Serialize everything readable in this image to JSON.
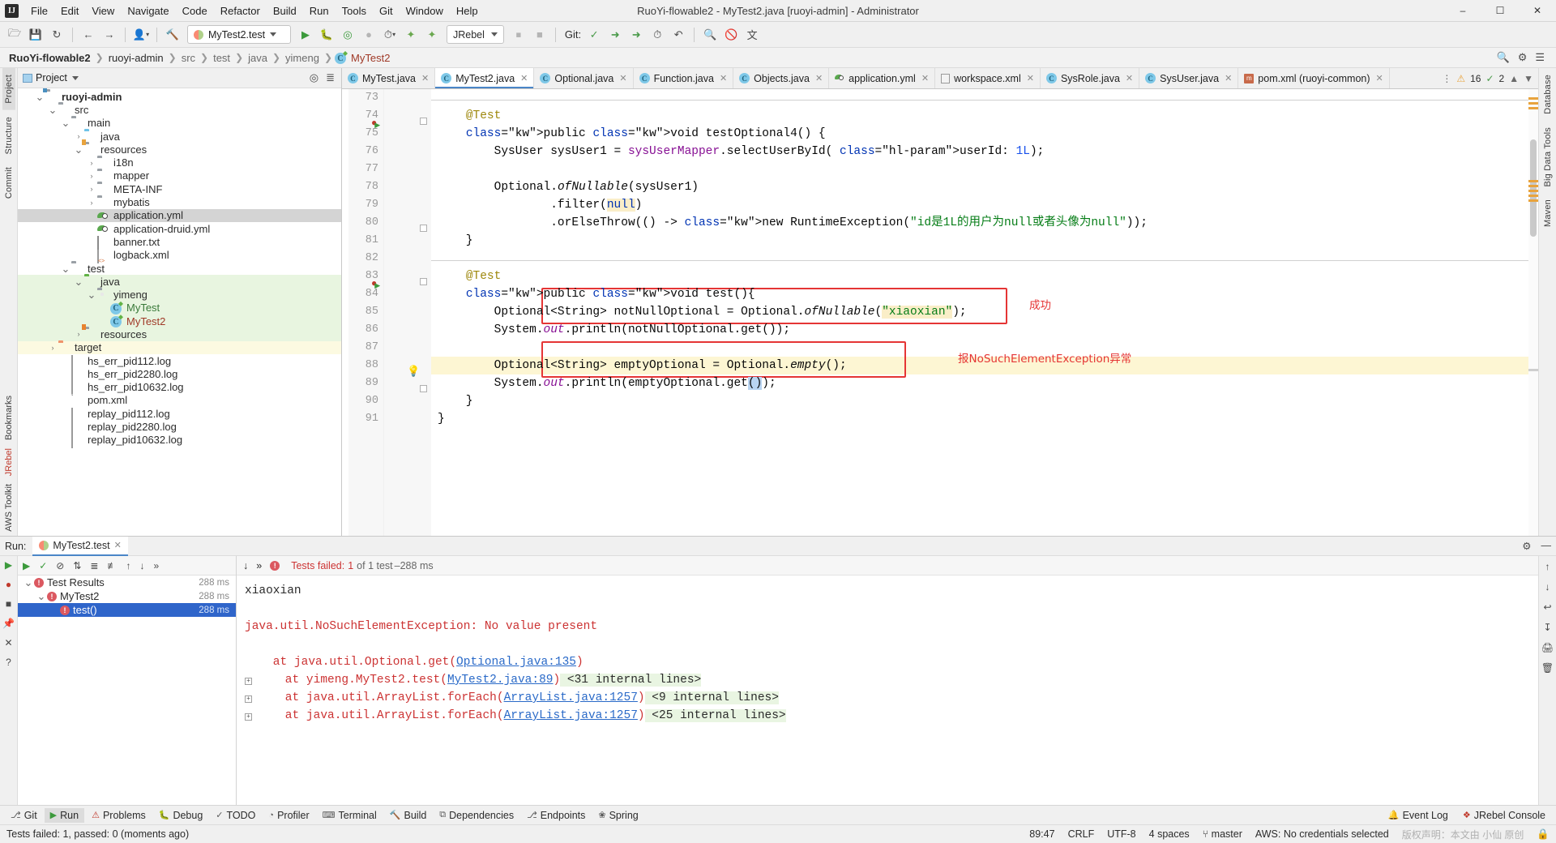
{
  "titlebar": {
    "logo": "IJ",
    "title": "RuoYi-flowable2 - MyTest2.java [ruoyi-admin] - Administrator",
    "menus": [
      "File",
      "Edit",
      "View",
      "Navigate",
      "Code",
      "Refactor",
      "Build",
      "Run",
      "Tools",
      "Git",
      "Window",
      "Help"
    ],
    "window_buttons": [
      "minimize",
      "maximize",
      "close"
    ]
  },
  "toolbar": {
    "run_config": "MyTest2.test",
    "jrebel": "JRebel",
    "git_label": "Git:",
    "icons": [
      "open-folder-icon",
      "save-icon",
      "sync-icon",
      "back-arrow-icon",
      "forward-arrow-icon",
      "profile-icon",
      "build-hammer-icon"
    ],
    "run_icons": [
      "run-icon",
      "debug-icon",
      "run-coverage-icon",
      "profile-run-icon",
      "run-with-icon"
    ],
    "jrebel_icons": [
      "jrebel-run-icon",
      "jrebel-debug-icon"
    ],
    "right_icons": [
      "search-icon",
      "settings-icon",
      "layout-icon"
    ]
  },
  "breadcrumb": {
    "items": [
      "RuoYi-flowable2",
      "ruoyi-admin",
      "src",
      "test",
      "java",
      "yimeng",
      "MyTest2"
    ],
    "separator": "›"
  },
  "left_bar": {
    "tabs": [
      "Project",
      "Structure",
      "Commit"
    ]
  },
  "right_bar": {
    "tabs": [
      "Database",
      "Big Data Tools",
      "Maven"
    ]
  },
  "project_panel": {
    "title": "Project",
    "header_icons": [
      "locate-icon",
      "collapse-all-icon"
    ],
    "tree": [
      {
        "indent": 1,
        "arrow": "v",
        "icon": "module-folder-icon",
        "label": "ruoyi-admin",
        "bold": true,
        "bg": ""
      },
      {
        "indent": 2,
        "arrow": "v",
        "icon": "folder-icon",
        "label": "src",
        "bg": ""
      },
      {
        "indent": 3,
        "arrow": "v",
        "icon": "folder-icon",
        "label": "main",
        "bg": ""
      },
      {
        "indent": 4,
        "arrow": ">",
        "icon": "source-folder-icon",
        "label": "java",
        "bg": ""
      },
      {
        "indent": 4,
        "arrow": "v",
        "icon": "resource-folder-icon",
        "label": "resources",
        "bg": ""
      },
      {
        "indent": 5,
        "arrow": ">",
        "icon": "folder-icon",
        "label": "i18n",
        "bg": ""
      },
      {
        "indent": 5,
        "arrow": ">",
        "icon": "folder-icon",
        "label": "mapper",
        "bg": ""
      },
      {
        "indent": 5,
        "arrow": ">",
        "icon": "folder-icon",
        "label": "META-INF",
        "bg": ""
      },
      {
        "indent": 5,
        "arrow": ">",
        "icon": "folder-icon",
        "label": "mybatis",
        "bg": ""
      },
      {
        "indent": 5,
        "arrow": "",
        "icon": "yml-file-icon",
        "label": "application.yml",
        "bg": "sel",
        "color": "#2b2b2b"
      },
      {
        "indent": 5,
        "arrow": "",
        "icon": "yml-file-icon",
        "label": "application-druid.yml",
        "bg": "",
        "color": "#2b2b2b"
      },
      {
        "indent": 5,
        "arrow": "",
        "icon": "text-file-icon",
        "label": "banner.txt",
        "bg": ""
      },
      {
        "indent": 5,
        "arrow": "",
        "icon": "xml-file-icon",
        "label": "logback.xml",
        "bg": ""
      },
      {
        "indent": 3,
        "arrow": "v",
        "icon": "folder-icon",
        "label": "test",
        "bg": ""
      },
      {
        "indent": 4,
        "arrow": "v",
        "icon": "test-source-folder-icon",
        "label": "java",
        "bg": "green"
      },
      {
        "indent": 5,
        "arrow": "v",
        "icon": "package-icon",
        "label": "yimeng",
        "bg": "green"
      },
      {
        "indent": 6,
        "arrow": "",
        "icon": "java-class-icon",
        "label": "MyTest",
        "bg": "green",
        "color": "#3a7a3a"
      },
      {
        "indent": 6,
        "arrow": "",
        "icon": "java-class-icon",
        "label": "MyTest2",
        "bg": "green",
        "color": "#a03a28"
      },
      {
        "indent": 4,
        "arrow": ">",
        "icon": "test-resource-folder-icon",
        "label": "resources",
        "bg": "green"
      },
      {
        "indent": 2,
        "arrow": ">",
        "icon": "target-folder-icon",
        "label": "target",
        "bg": "yellow"
      },
      {
        "indent": 3,
        "arrow": "",
        "icon": "log-file-icon",
        "label": "hs_err_pid112.log",
        "bg": ""
      },
      {
        "indent": 3,
        "arrow": "",
        "icon": "log-file-icon",
        "label": "hs_err_pid2280.log",
        "bg": ""
      },
      {
        "indent": 3,
        "arrow": "",
        "icon": "log-file-icon",
        "label": "hs_err_pid10632.log",
        "bg": ""
      },
      {
        "indent": 3,
        "arrow": "",
        "icon": "maven-pom-icon",
        "label": "pom.xml",
        "bg": ""
      },
      {
        "indent": 3,
        "arrow": "",
        "icon": "log-file-icon",
        "label": "replay_pid112.log",
        "bg": ""
      },
      {
        "indent": 3,
        "arrow": "",
        "icon": "log-file-icon",
        "label": "replay_pid2280.log",
        "bg": ""
      },
      {
        "indent": 3,
        "arrow": "",
        "icon": "log-file-icon",
        "label": "replay_pid10632.log",
        "bg": ""
      }
    ]
  },
  "editor": {
    "tabs": [
      {
        "label": "MyTest.java",
        "icon": "java-class-icon",
        "active": false,
        "closable": true
      },
      {
        "label": "MyTest2.java",
        "icon": "java-class-icon",
        "active": true,
        "closable": true
      },
      {
        "label": "Optional.java",
        "icon": "java-class-icon",
        "active": false,
        "closable": true
      },
      {
        "label": "Function.java",
        "icon": "java-class-icon",
        "active": false,
        "closable": true
      },
      {
        "label": "Objects.java",
        "icon": "java-class-icon",
        "active": false,
        "closable": true
      },
      {
        "label": "application.yml",
        "icon": "yml-file-icon",
        "active": false,
        "closable": true
      },
      {
        "label": "workspace.xml",
        "icon": "xml-file-icon",
        "active": false,
        "closable": true
      },
      {
        "label": "SysRole.java",
        "icon": "java-class-icon",
        "active": false,
        "closable": true
      },
      {
        "label": "SysUser.java",
        "icon": "java-class-icon",
        "active": false,
        "closable": true
      },
      {
        "label": "pom.xml (ruoyi-common)",
        "icon": "maven-pom-icon",
        "active": false,
        "closable": true
      }
    ],
    "inspection": {
      "warnings": "16",
      "checks": "2"
    },
    "first_line_number": 73,
    "lines": [
      {
        "n": 73,
        "text": ""
      },
      {
        "n": 74,
        "text": "    @Test"
      },
      {
        "n": 75,
        "text": "    public void testOptional4() {"
      },
      {
        "n": 76,
        "text": "        SysUser sysUser1 = sysUserMapper.selectUserById( userId: 1L);"
      },
      {
        "n": 77,
        "text": ""
      },
      {
        "n": 78,
        "text": "        Optional.ofNullable(sysUser1)"
      },
      {
        "n": 79,
        "text": "                .filter(null)"
      },
      {
        "n": 80,
        "text": "                .orElseThrow(() -> new RuntimeException(\"id是1L的用户为null或者头像为null\"));"
      },
      {
        "n": 81,
        "text": "    }"
      },
      {
        "n": 82,
        "text": ""
      },
      {
        "n": 83,
        "text": "    @Test"
      },
      {
        "n": 84,
        "text": "    public void test(){"
      },
      {
        "n": 85,
        "text": "        Optional<String> notNullOptional = Optional.ofNullable(\"xiaoxian\");"
      },
      {
        "n": 86,
        "text": "        System.out.println(notNullOptional.get());"
      },
      {
        "n": 87,
        "text": ""
      },
      {
        "n": 88,
        "text": "        Optional<String> emptyOptional = Optional.empty();"
      },
      {
        "n": 89,
        "text": "        System.out.println(emptyOptional.get());"
      },
      {
        "n": 90,
        "text": "    }"
      },
      {
        "n": 91,
        "text": "}"
      }
    ],
    "annotations": [
      {
        "text": "成功",
        "color": "#e53535"
      },
      {
        "text": "报NoSuchElementException异常",
        "color": "#e53535"
      }
    ]
  },
  "run_panel": {
    "label": "Run:",
    "tab": "MyTest2.test",
    "tab_icon": "run-config-icon",
    "toolbar_icons": [
      "rerun-icon",
      "rerun-failed-icon",
      "toggle-icon",
      "sort-icon",
      "expand-icon",
      "collapse-icon",
      "up-icon",
      "down-icon",
      "more-icon"
    ],
    "status": {
      "prefix": "Tests failed:",
      "count": "1",
      "of": "of 1 test",
      "duration": "288 ms"
    },
    "tree": [
      {
        "indent": 0,
        "arrow": "v",
        "label": "Test Results",
        "time": "288 ms",
        "sel": false,
        "error": true
      },
      {
        "indent": 1,
        "arrow": "v",
        "label": "MyTest2",
        "time": "288 ms",
        "sel": false,
        "error": true
      },
      {
        "indent": 2,
        "arrow": "",
        "label": "test()",
        "time": "288 ms",
        "sel": true,
        "error": true
      }
    ],
    "console": [
      {
        "segments": [
          {
            "t": "xiaoxian",
            "c": "plain"
          }
        ]
      },
      {
        "segments": []
      },
      {
        "segments": [
          {
            "t": "java.util.NoSuchElementException: No value present",
            "c": "err"
          }
        ]
      },
      {
        "segments": []
      },
      {
        "segments": [
          {
            "t": "    at java.util.Optional.get(",
            "c": "err"
          },
          {
            "t": "Optional.java:135",
            "c": "link"
          },
          {
            "t": ")",
            "c": "err"
          }
        ]
      },
      {
        "segments": [
          {
            "t": "    at yimeng.MyTest2.test(",
            "c": "err"
          },
          {
            "t": "MyTest2.java:89",
            "c": "link"
          },
          {
            "t": ")",
            "c": "err"
          },
          {
            "t": " <31 internal lines>",
            "c": "green"
          }
        ],
        "expandable": true
      },
      {
        "segments": [
          {
            "t": "    at java.util.ArrayList.forEach(",
            "c": "err"
          },
          {
            "t": "ArrayList.java:1257",
            "c": "link"
          },
          {
            "t": ")",
            "c": "err"
          },
          {
            "t": " <9 internal lines>",
            "c": "green"
          }
        ],
        "expandable": true
      },
      {
        "segments": [
          {
            "t": "    at java.util.ArrayList.forEach(",
            "c": "err"
          },
          {
            "t": "ArrayList.java:1257",
            "c": "link"
          },
          {
            "t": ")",
            "c": "err"
          },
          {
            "t": " <25 internal lines>",
            "c": "green"
          }
        ],
        "expandable": true
      }
    ],
    "side_icons": [
      "up-icon",
      "down-icon",
      "soft-wrap-icon",
      "scroll-to-end-icon",
      "print-icon",
      "clear-icon"
    ]
  },
  "bottom_bar": {
    "items": [
      {
        "label": "Git",
        "icon": "git-icon",
        "active": false
      },
      {
        "label": "Run",
        "icon": "run-icon",
        "active": true
      },
      {
        "label": "Problems",
        "icon": "problems-icon",
        "active": false
      },
      {
        "label": "Debug",
        "icon": "debug-icon",
        "active": false
      },
      {
        "label": "TODO",
        "icon": "todo-icon",
        "active": false
      },
      {
        "label": "Profiler",
        "icon": "profiler-icon",
        "active": false
      },
      {
        "label": "Terminal",
        "icon": "terminal-icon",
        "active": false
      },
      {
        "label": "Build",
        "icon": "build-icon",
        "active": false
      },
      {
        "label": "Dependencies",
        "icon": "dependencies-icon",
        "active": false
      },
      {
        "label": "Endpoints",
        "icon": "endpoints-icon",
        "active": false
      },
      {
        "label": "Spring",
        "icon": "spring-icon",
        "active": false
      }
    ],
    "right": [
      {
        "label": "Event Log",
        "icon": "event-log-icon"
      },
      {
        "label": "JRebel Console",
        "icon": "jrebel-icon"
      }
    ]
  },
  "status_bar": {
    "message": "Tests failed: 1, passed: 0 (moments ago)",
    "position": "89:47",
    "line_sep": "CRLF",
    "encoding": "UTF-8",
    "indent": "4 spaces",
    "branch": "master",
    "aws": "AWS: No credentials selected",
    "lock_icon": "lock-icon",
    "watermark": "版权声明：本文由 小仙 原创"
  },
  "colors": {
    "accent": "#4a86c8",
    "error": "#cc3333",
    "annotation_red": "#e53535",
    "keyword": "#0033b3",
    "string": "#067d17",
    "number": "#1750eb",
    "field": "#871094",
    "test_folder_bg": "#e8f5e0",
    "target_folder_bg": "#fcfae1",
    "selection": "#2f65ca"
  }
}
